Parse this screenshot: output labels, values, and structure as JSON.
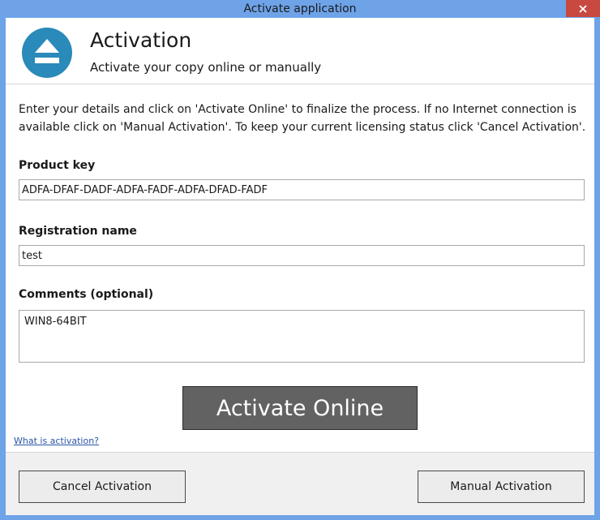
{
  "window": {
    "title": "Activate application"
  },
  "header": {
    "title": "Activation",
    "subtitle": "Activate your copy online or manually",
    "logo_icon": "eject-icon"
  },
  "instructions": "Enter your details and click on 'Activate Online' to finalize the process. If no Internet connection is available click on 'Manual Activation'. To keep your current licensing status click 'Cancel Activation'.",
  "form": {
    "product_key_label": "Product key",
    "product_key_value": "ADFA-DFAF-DADF-ADFA-FADF-ADFA-DFAD-FADF",
    "registration_name_label": "Registration name",
    "registration_name_value": "test",
    "comments_label": "Comments (optional)",
    "comments_value": "WIN8-64BIT"
  },
  "actions": {
    "activate_online_label": "Activate Online",
    "help_link_label": "What is activation?",
    "cancel_label": "Cancel Activation",
    "manual_label": "Manual Activation"
  },
  "colors": {
    "titlebar": "#6ea3e8",
    "close_button": "#c7493f",
    "logo": "#2a8ab9",
    "activate_button": "#626262",
    "link": "#2a55a8"
  }
}
